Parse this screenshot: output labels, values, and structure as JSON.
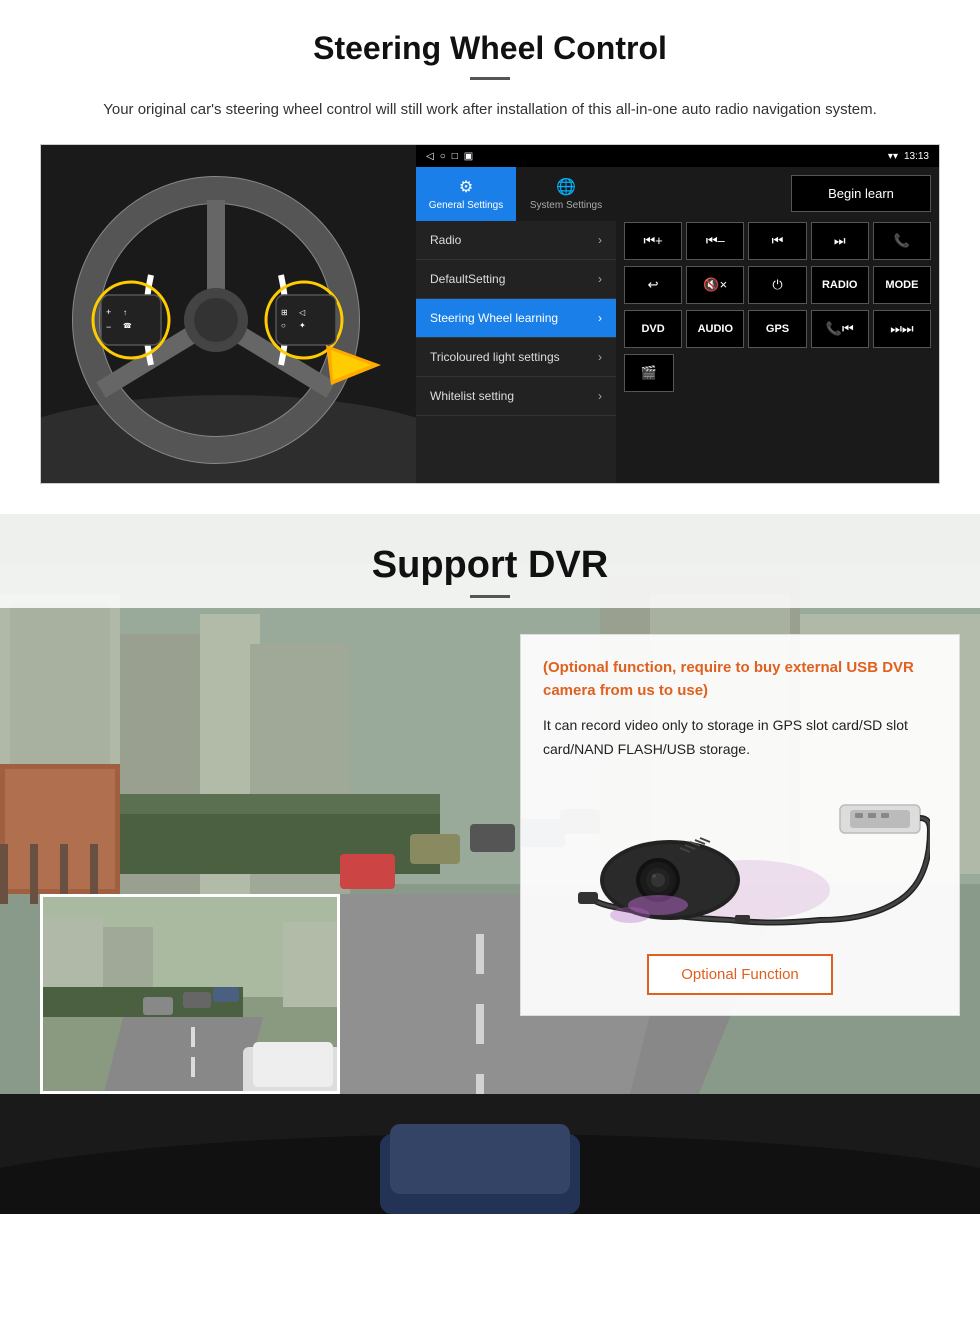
{
  "steering": {
    "title": "Steering Wheel Control",
    "subtitle": "Your original car's steering wheel control will still work after installation of this all-in-one auto radio navigation system.",
    "statusbar": {
      "time": "13:13",
      "signal": "▼",
      "wifi": "▲"
    },
    "nav_buttons": [
      "◁",
      "○",
      "□",
      "■"
    ],
    "tabs": [
      {
        "label": "General Settings",
        "icon": "⚙",
        "active": true
      },
      {
        "label": "System Settings",
        "icon": "🌐",
        "active": false
      }
    ],
    "menu_items": [
      {
        "label": "Radio",
        "active": false
      },
      {
        "label": "DefaultSetting",
        "active": false
      },
      {
        "label": "Steering Wheel learning",
        "active": true
      },
      {
        "label": "Tricoloured light settings",
        "active": false
      },
      {
        "label": "Whitelist setting",
        "active": false
      }
    ],
    "begin_learn": "Begin learn",
    "control_rows": [
      [
        "⏮+",
        "⏮-",
        "⏮⏮",
        "⏭⏭",
        "📞"
      ],
      [
        "↩",
        "🔇x",
        "⏻",
        "RADIO",
        "MODE"
      ],
      [
        "DVD",
        "AUDIO",
        "GPS",
        "📞⏮",
        "⏭⏭"
      ],
      [
        "📷"
      ]
    ]
  },
  "dvr": {
    "title": "Support DVR",
    "optional_note": "(Optional function, require to buy external USB DVR camera from us to use)",
    "description": "It can record video only to storage in GPS slot card/SD slot card/NAND FLASH/USB storage.",
    "optional_function_label": "Optional Function"
  }
}
